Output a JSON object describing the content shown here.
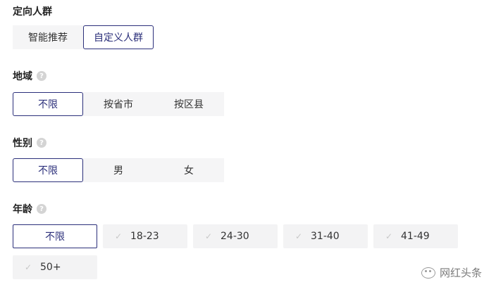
{
  "audience": {
    "title": "定向人群",
    "options": [
      {
        "label": "智能推荐",
        "selected": false
      },
      {
        "label": "自定义人群",
        "selected": true
      }
    ]
  },
  "region": {
    "title": "地域",
    "help_icon": "question-circle-icon",
    "options": [
      {
        "label": "不限",
        "selected": true
      },
      {
        "label": "按省市",
        "selected": false
      },
      {
        "label": "按区县",
        "selected": false
      }
    ]
  },
  "gender": {
    "title": "性别",
    "help_icon": "question-circle-icon",
    "options": [
      {
        "label": "不限",
        "selected": true
      },
      {
        "label": "男",
        "selected": false
      },
      {
        "label": "女",
        "selected": false
      }
    ]
  },
  "age": {
    "title": "年龄",
    "help_icon": "question-circle-icon",
    "options": [
      {
        "label": "不限",
        "selected": true
      },
      {
        "label": "18-23",
        "selected": false
      },
      {
        "label": "24-30",
        "selected": false
      },
      {
        "label": "31-40",
        "selected": false
      },
      {
        "label": "41-49",
        "selected": false
      },
      {
        "label": "50+",
        "selected": false
      }
    ]
  },
  "watermark": {
    "text": "网红头条",
    "icon": "wechat-icon"
  },
  "colors": {
    "accent": "#2b2f7a",
    "segment_bg": "#f5f5f6",
    "help_icon": "#d4d4d4"
  }
}
